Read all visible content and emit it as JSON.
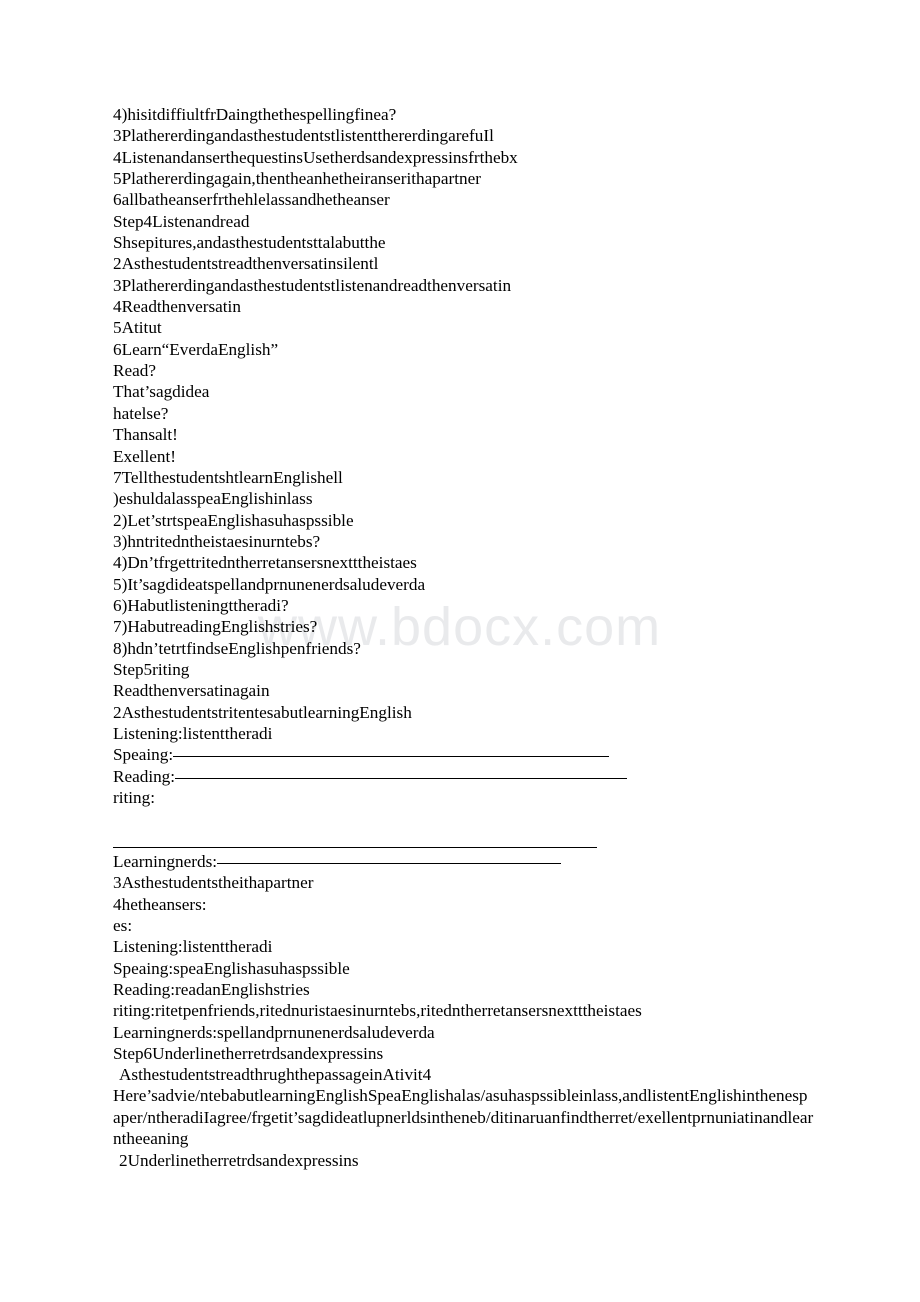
{
  "page": {
    "watermark": "www.bdocx.com",
    "background_color": "#ffffff",
    "text_color": "#000000",
    "watermark_color": "#e9eaec"
  },
  "body_lines": [
    {
      "text": "4)hisitdiffiultfrDaingthethespellingfinea?",
      "indent": false
    },
    {
      "text": "3PlathererdingandasthestudentstlistentthererdingarefuIl",
      "indent": false
    },
    {
      "text": "4ListenandanserthequestinsUsetherdsandexpressinsfrthebx",
      "indent": false
    },
    {
      "text": "5Plathererdingagain,thentheanhetheiranserithapartner",
      "indent": false
    },
    {
      "text": "6allbatheanserfrthehlelassandhetheanser",
      "indent": false
    },
    {
      "text": "Step4Listenandread",
      "indent": false
    },
    {
      "text": "Shsepitures,andasthestudentsttalabutthe",
      "indent": false
    },
    {
      "text": "2Asthestudentstreadthenversatinsilentl",
      "indent": false
    },
    {
      "text": "3Plathererdingandasthestudentstlistenandreadthenversatin",
      "indent": false
    },
    {
      "text": "4Readthenversatin",
      "indent": false
    },
    {
      "text": "5Atitut",
      "indent": false
    },
    {
      "text": "6Learn“EverdaEnglish”",
      "indent": false
    },
    {
      "text": "Read?",
      "indent": false
    },
    {
      "text": "That’sagdidea",
      "indent": false
    },
    {
      "text": "hatelse?",
      "indent": false
    },
    {
      "text": "Thansalt!",
      "indent": false
    },
    {
      "text": "Exellent!",
      "indent": false
    },
    {
      "text": "7TellthestudentshtlearnEnglishell",
      "indent": false
    },
    {
      "text": ")eshuldalasspeaEnglishinlass",
      "indent": false
    },
    {
      "text": "2)Let’strtspeaEnglishasuhaspssible",
      "indent": false
    },
    {
      "text": "3)hntritedntheistaesinurntebs?",
      "indent": false
    },
    {
      "text": "4)Dn’tfrgettritedntherretansersnextttheistaes",
      "indent": false
    },
    {
      "text": "5)It’sagdideatspellandprnunenerdsaludeverda",
      "indent": false
    },
    {
      "text": "6)Habutlisteningttheradi?",
      "indent": false
    },
    {
      "text": "7)HabutreadingEnglishstries?",
      "indent": false
    },
    {
      "text": "8)hdn’tetrtfindseEnglishpenfriends?",
      "indent": false
    },
    {
      "text": "Step5riting",
      "indent": false
    },
    {
      "text": "Readthenversatinagain",
      "indent": false
    },
    {
      "text": "2AsthestudentstritentesabutlearningEnglish",
      "indent": false
    },
    {
      "text": "Listening:listenttheradi",
      "indent": false
    }
  ],
  "fill_rows": {
    "speaking_label": "Speaing:",
    "reading_label": "Reading:",
    "writing_label": "riting:",
    "goals_label": "Learningnerds:"
  },
  "body_lines_2": [
    {
      "text": "3Asthestudentstheithapartner",
      "indent": false
    },
    {
      "text": "4hetheansers:",
      "indent": false
    },
    {
      "text": "es:",
      "indent": false
    },
    {
      "text": "Listening:listenttheradi",
      "indent": false
    },
    {
      "text": "Speaing:speaEnglishasuhaspssible",
      "indent": false
    },
    {
      "text": "Reading:readanEnglishstries",
      "indent": false
    },
    {
      "text": "riting:ritetpenfriends,ritednuristaesinurntebs,ritedntherretansersnextttheistaes",
      "indent": false
    },
    {
      "text": "Learningnerds:spellandprnunenerdsaludeverda",
      "indent": false
    },
    {
      "text": "Step6Underlinetherretrdsandexpressins",
      "indent": false
    },
    {
      "text": "AsthestudentstreadthrughthepassageinAtivit4",
      "indent": true
    }
  ],
  "tail": {
    "paragraph": "Here’sadvie/ntebabutlearningEnglishSpeaEnglishalas/asuhaspssibleinlass,andlistentEnglishinthenespaper/ntheradiIagree/frgetit’sagdideatlupnerldsintheneb/ditinaruanfindtherret/exellentprnuniatinandlearntheeaning",
    "last_line": "2Underlinetherretrdsandexpressins"
  }
}
